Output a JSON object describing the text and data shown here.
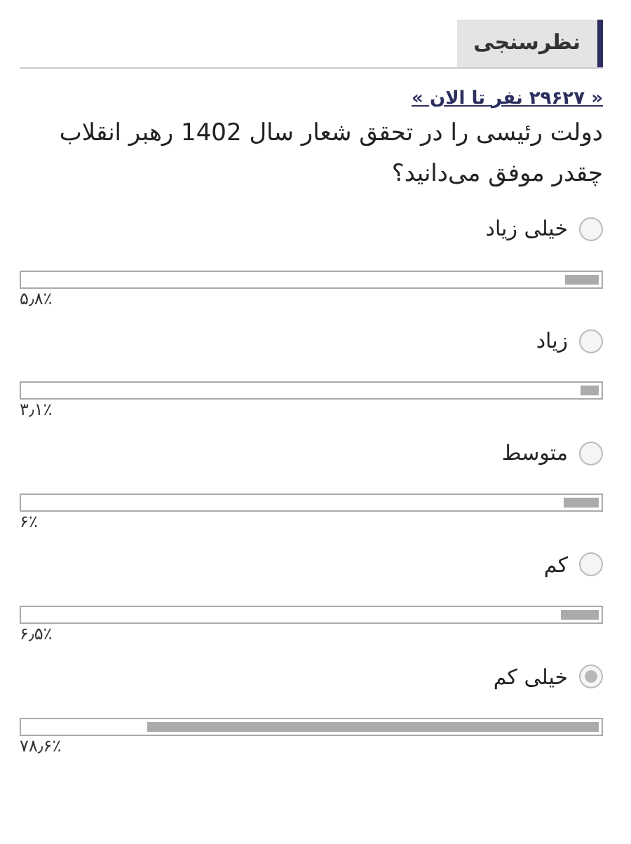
{
  "header": {
    "title": "نظرسنجی"
  },
  "poll": {
    "participants_link": "« ۲۹۶۲۷ نفر تا الان »",
    "question": "دولت رئیسی را در تحقق شعار سال 1402 رهبر انقلاب چقدر موفق می‌دانید؟",
    "options": [
      {
        "label": "خیلی زیاد",
        "selected": false,
        "level": 0.058,
        "percent": "۵٫۸٪"
      },
      {
        "label": "زیاد",
        "selected": false,
        "level": 0.031,
        "percent": "۳٫۱٪"
      },
      {
        "label": "متوسط",
        "selected": false,
        "level": 0.06,
        "percent": "۶٪"
      },
      {
        "label": "کم",
        "selected": false,
        "level": 0.065,
        "percent": "۶٫۵٪"
      },
      {
        "label": "خیلی کم",
        "selected": true,
        "level": 0.786,
        "percent": "۷۸٫۶٪"
      }
    ]
  }
}
